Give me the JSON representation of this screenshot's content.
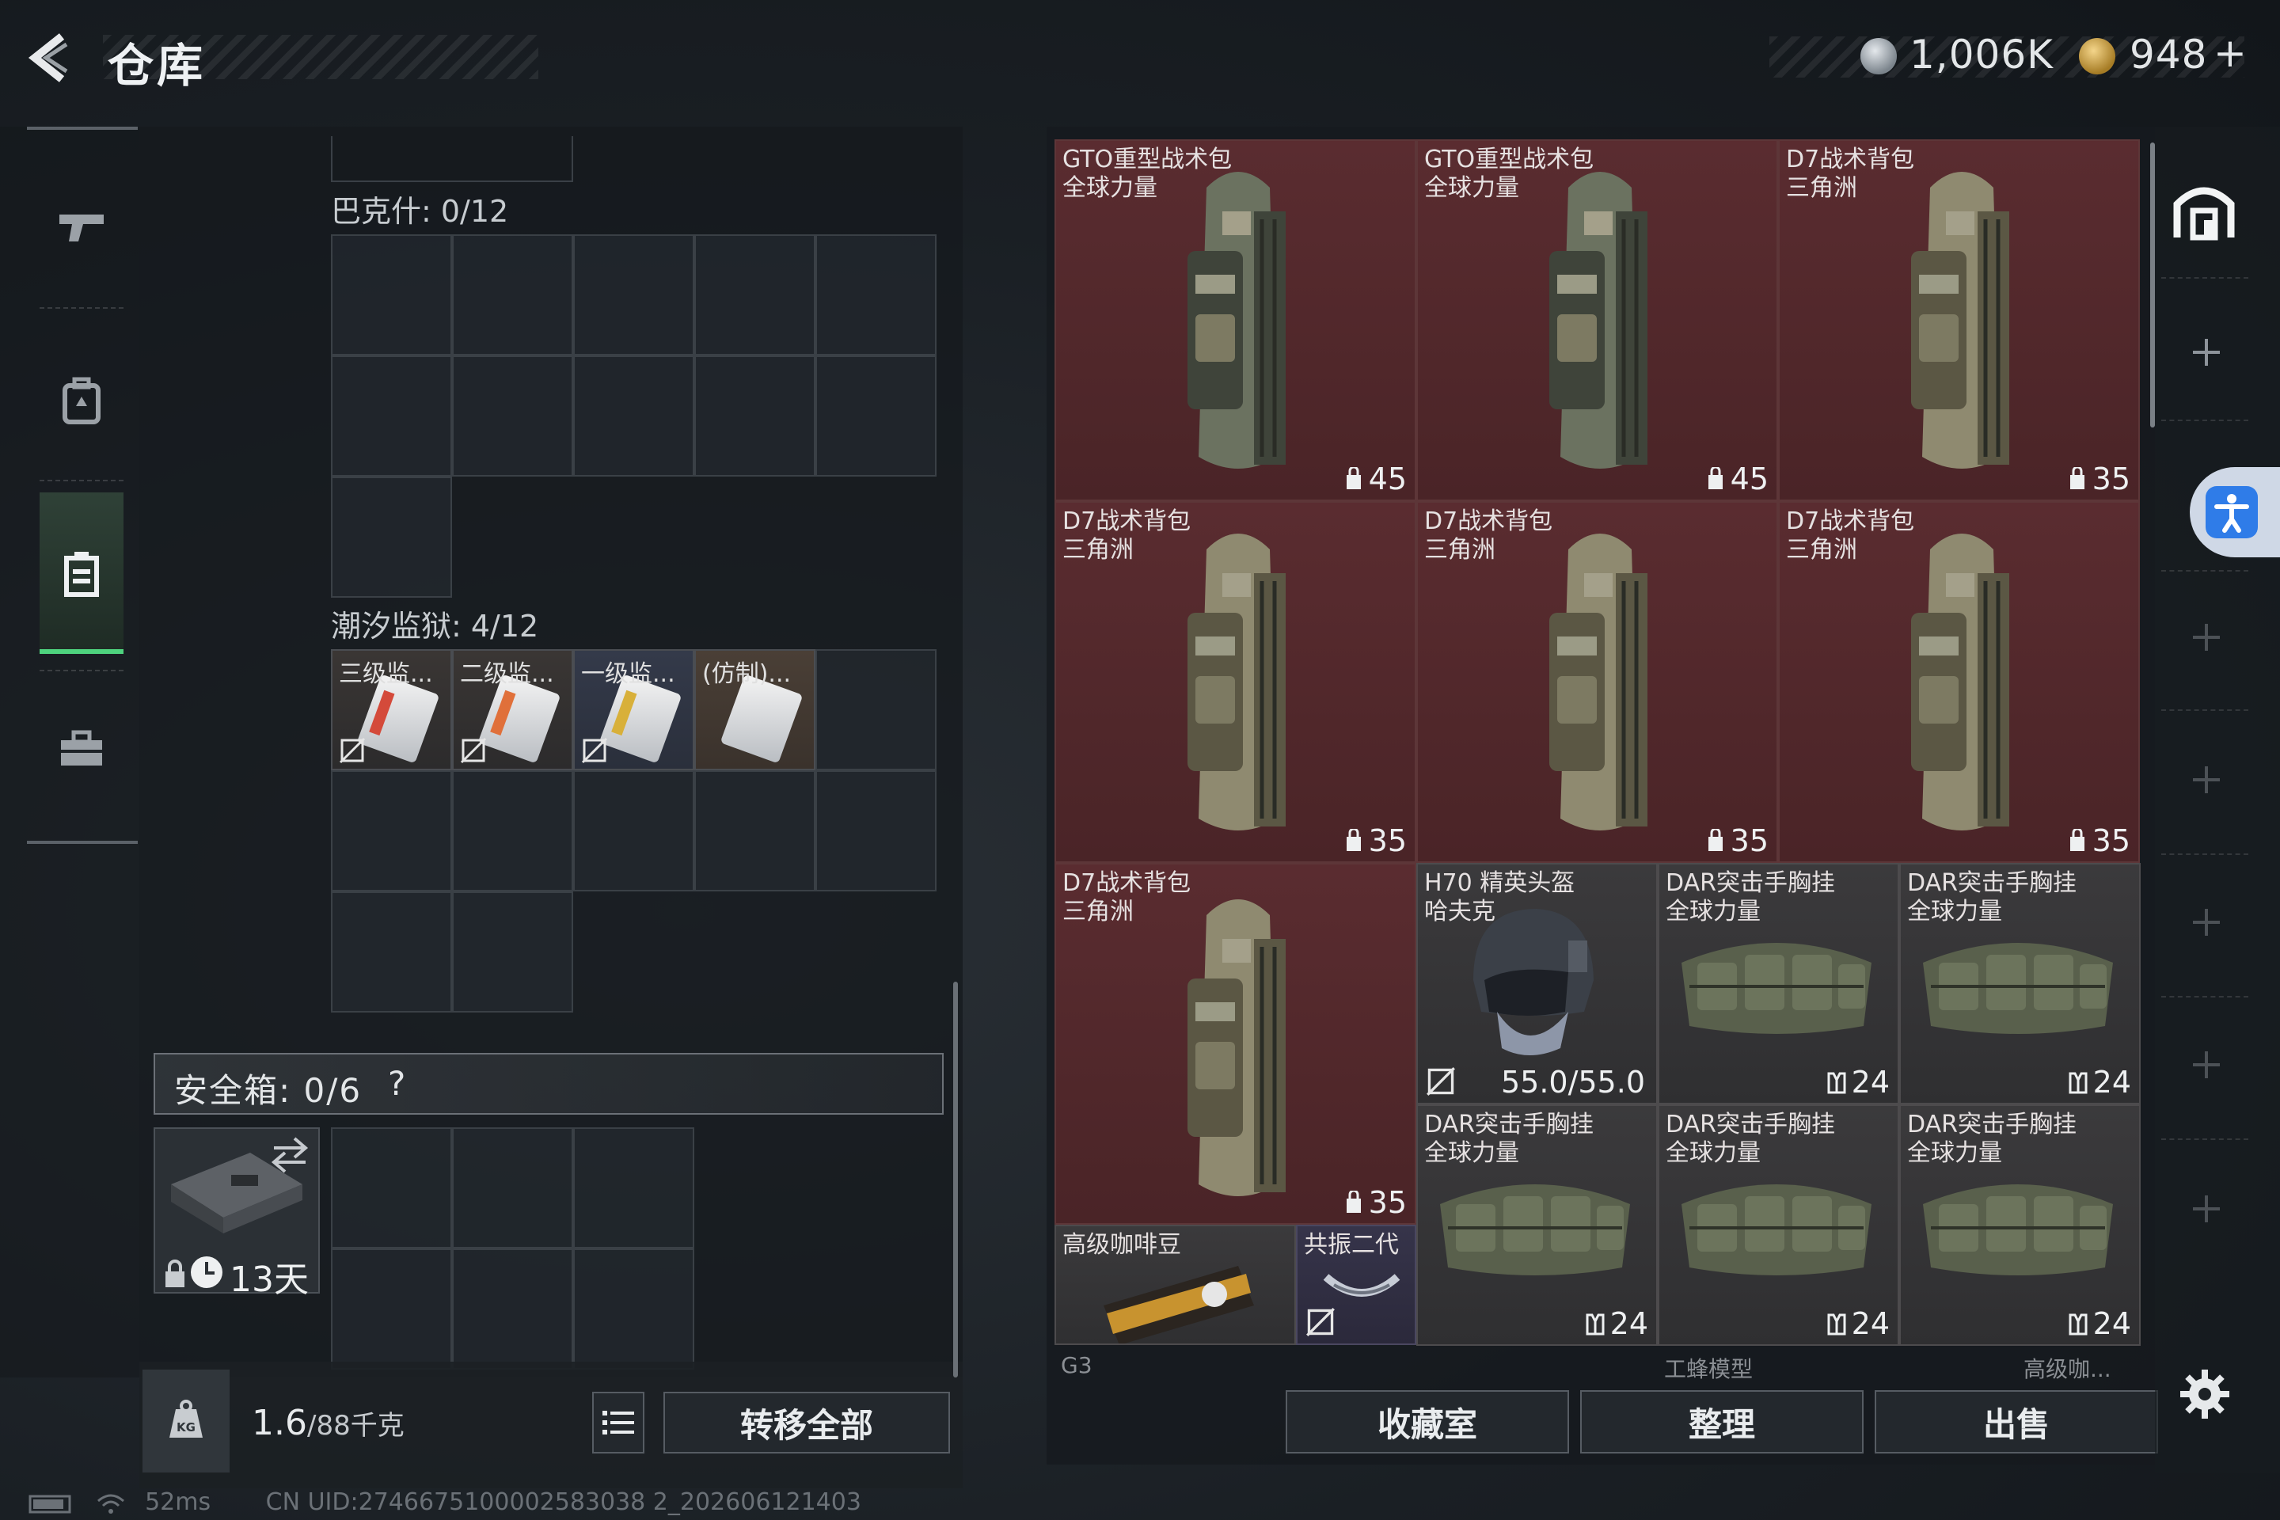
{
  "header": {
    "title": "仓库",
    "currency": [
      {
        "name": "coin",
        "value": "1,006K",
        "color": "#a9b0b7"
      },
      {
        "name": "gem",
        "value": "948",
        "color": "#c9a24a",
        "suffix": "+"
      }
    ]
  },
  "left_panel": {
    "section_bakshi": {
      "label": "巴克什: 0/12"
    },
    "section_tide_prison": {
      "label": "潮汐监狱: 4/12",
      "keys": [
        {
          "label": "三级监...",
          "stripe": "#d44a3a"
        },
        {
          "label": "二级监...",
          "stripe": "#e0703a"
        },
        {
          "label": "一级监...",
          "stripe": "#d8b03a"
        },
        {
          "label": "(仿制)..."
        }
      ]
    },
    "safe": {
      "label": "安全箱: 0/6",
      "help": "?",
      "days": "13天"
    },
    "weight": {
      "value": "1.6",
      "capacity": "/88千克"
    },
    "transfer_all": "转移全部"
  },
  "inventory": {
    "items": [
      {
        "name1": "GTO重型战术包",
        "name2": "全球力量",
        "count": "45",
        "kind": "backpack",
        "tint": "green"
      },
      {
        "name1": "GTO重型战术包",
        "name2": "全球力量",
        "count": "45",
        "kind": "backpack",
        "tint": "green"
      },
      {
        "name1": "D7战术背包",
        "name2": "三角洲",
        "count": "35",
        "kind": "backpack",
        "tint": "tan"
      },
      {
        "name1": "D7战术背包",
        "name2": "三角洲",
        "count": "35",
        "kind": "backpack",
        "tint": "tan"
      },
      {
        "name1": "D7战术背包",
        "name2": "三角洲",
        "count": "35",
        "kind": "backpack",
        "tint": "tan"
      },
      {
        "name1": "D7战术背包",
        "name2": "三角洲",
        "count": "35",
        "kind": "backpack",
        "tint": "tan"
      },
      {
        "name1": "D7战术背包",
        "name2": "三角洲",
        "count": "35",
        "kind": "backpack",
        "tint": "tan"
      },
      {
        "name1": "H70 精英头盔",
        "name2": "哈夫克",
        "durability": "55.0/55.0",
        "kind": "helmet"
      },
      {
        "name1": "DAR突击手胸挂",
        "name2": "全球力量",
        "count": "24",
        "kind": "rig"
      },
      {
        "name1": "DAR突击手胸挂",
        "name2": "全球力量",
        "count": "24",
        "kind": "rig"
      },
      {
        "name1": "DAR突击手胸挂",
        "name2": "全球力量",
        "count": "24",
        "kind": "rig"
      },
      {
        "name1": "DAR突击手胸挂",
        "name2": "全球力量",
        "count": "24",
        "kind": "rig"
      },
      {
        "name1": "DAR突击手胸挂",
        "name2": "全球力量",
        "count": "24",
        "kind": "rig"
      },
      {
        "name1": "高级咖啡豆",
        "kind": "coffee"
      },
      {
        "name1": "共振二代",
        "kind": "resonator"
      }
    ],
    "partial_labels": [
      "G3",
      "工蜂模型",
      "高级咖..."
    ]
  },
  "actions": {
    "collection": "收藏室",
    "sort": "整理",
    "sell": "出售"
  },
  "status": {
    "ping": "52ms",
    "uid": "CN UID:2746675100002583038 2_202606121403"
  },
  "colors": {
    "accent_green": "#4ed37e",
    "rare_red": "#5a2c30",
    "accessibility_blue": "#2f7ce8"
  }
}
